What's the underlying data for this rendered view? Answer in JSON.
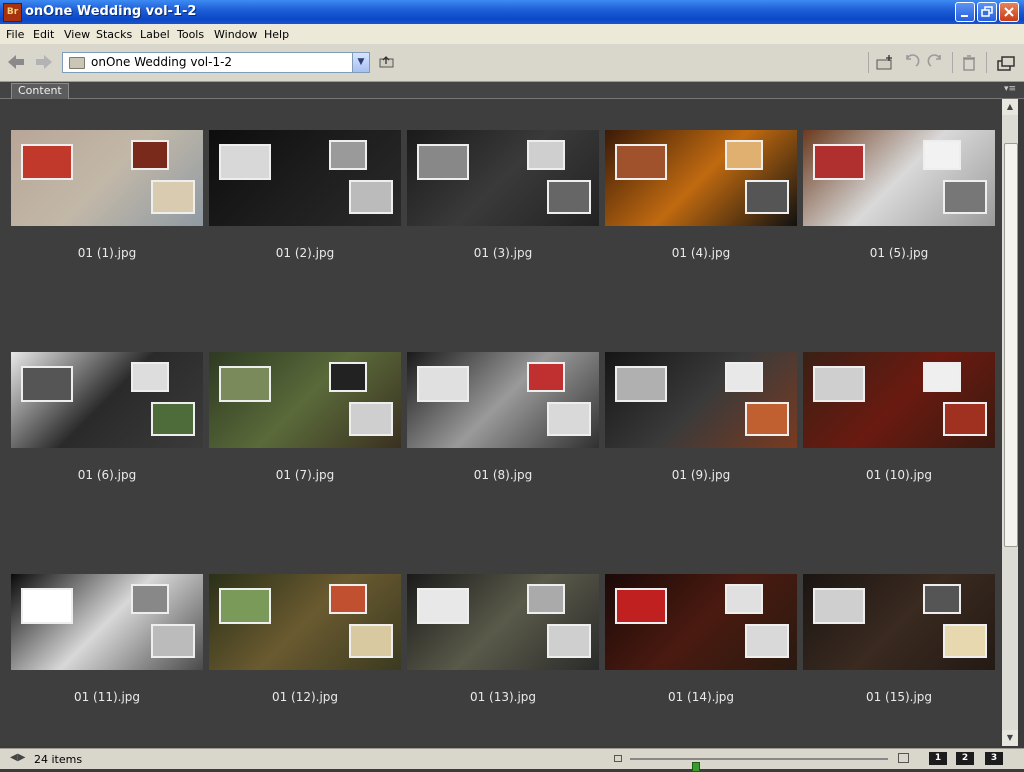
{
  "window": {
    "title": "onOne Wedding vol-1-2",
    "app_badge": "Br"
  },
  "menu": [
    "File",
    "Edit",
    "View",
    "Stacks",
    "Label",
    "Tools",
    "Window",
    "Help"
  ],
  "toolbar": {
    "path": "onOne Wedding vol-1-2"
  },
  "tabs": {
    "content": "Content"
  },
  "thumbnails": [
    {
      "label": "01 (1).jpg"
    },
    {
      "label": "01 (2).jpg"
    },
    {
      "label": "01 (3).jpg"
    },
    {
      "label": "01 (4).jpg"
    },
    {
      "label": "01 (5).jpg"
    },
    {
      "label": "01 (6).jpg"
    },
    {
      "label": "01 (7).jpg"
    },
    {
      "label": "01 (8).jpg"
    },
    {
      "label": "01 (9).jpg"
    },
    {
      "label": "01 (10).jpg"
    },
    {
      "label": "01 (11).jpg"
    },
    {
      "label": "01 (12).jpg"
    },
    {
      "label": "01 (13).jpg"
    },
    {
      "label": "01 (14).jpg"
    },
    {
      "label": "01 (15).jpg"
    }
  ],
  "palettes": [
    [
      "#b8a698",
      "#c2b8a8",
      "#8f9aa3",
      "#c0392b",
      "#7a2a1a",
      "#d9cbb0"
    ],
    [
      "#0d0d0d",
      "#1d1d1d",
      "#2a2a2a",
      "#d8d8d8",
      "#9a9a9a",
      "#bbbbbb"
    ],
    [
      "#1a1a1a",
      "#3a3a3a",
      "#222222",
      "#888888",
      "#cfcfcf",
      "#666666"
    ],
    [
      "#3a1a08",
      "#c06a10",
      "#111111",
      "#a0522d",
      "#e0b070",
      "#555555"
    ],
    [
      "#6b3a1e",
      "#d9d9d9",
      "#9a9a9a",
      "#b03030",
      "#f2f2f2",
      "#777777"
    ],
    [
      "#e8e8e8",
      "#2a2a2a",
      "#3b3b3b",
      "#555555",
      "#dddddd",
      "#4e6b3a"
    ],
    [
      "#2e3a22",
      "#5a6a3a",
      "#3a3020",
      "#7a8a5a",
      "#222222",
      "#cfcfcf"
    ],
    [
      "#1a1a1a",
      "#9a9a9a",
      "#303030",
      "#e0e0e0",
      "#c03030",
      "#d9d9d9"
    ],
    [
      "#151515",
      "#3a3a3a",
      "#7a3a20",
      "#b0b0b0",
      "#e8e8e8",
      "#c06030"
    ],
    [
      "#3a2015",
      "#6a1a10",
      "#3a1a10",
      "#cfcfcf",
      "#efefef",
      "#a03020"
    ],
    [
      "#0a0a0a",
      "#d8d8d8",
      "#4a4a4a",
      "#ffffff",
      "#888888",
      "#bbbbbb"
    ],
    [
      "#2a3018",
      "#6a5a30",
      "#3a3a20",
      "#7a9a5a",
      "#c05030",
      "#d9c9a0"
    ],
    [
      "#1a1a1a",
      "#5a5a4a",
      "#2a2a2a",
      "#e8e8e8",
      "#aaaaaa",
      "#cfcfcf"
    ],
    [
      "#1a0a08",
      "#4a1a10",
      "#2a1a10",
      "#c02020",
      "#e0e0e0",
      "#d9d9d9"
    ],
    [
      "#1a1512",
      "#3a2a20",
      "#231a14",
      "#cfcfcf",
      "#555555",
      "#e8d8b0"
    ]
  ],
  "status": {
    "items": "24 items",
    "zoom_level": 0.25
  },
  "view_buttons": [
    "1",
    "2",
    "3"
  ]
}
